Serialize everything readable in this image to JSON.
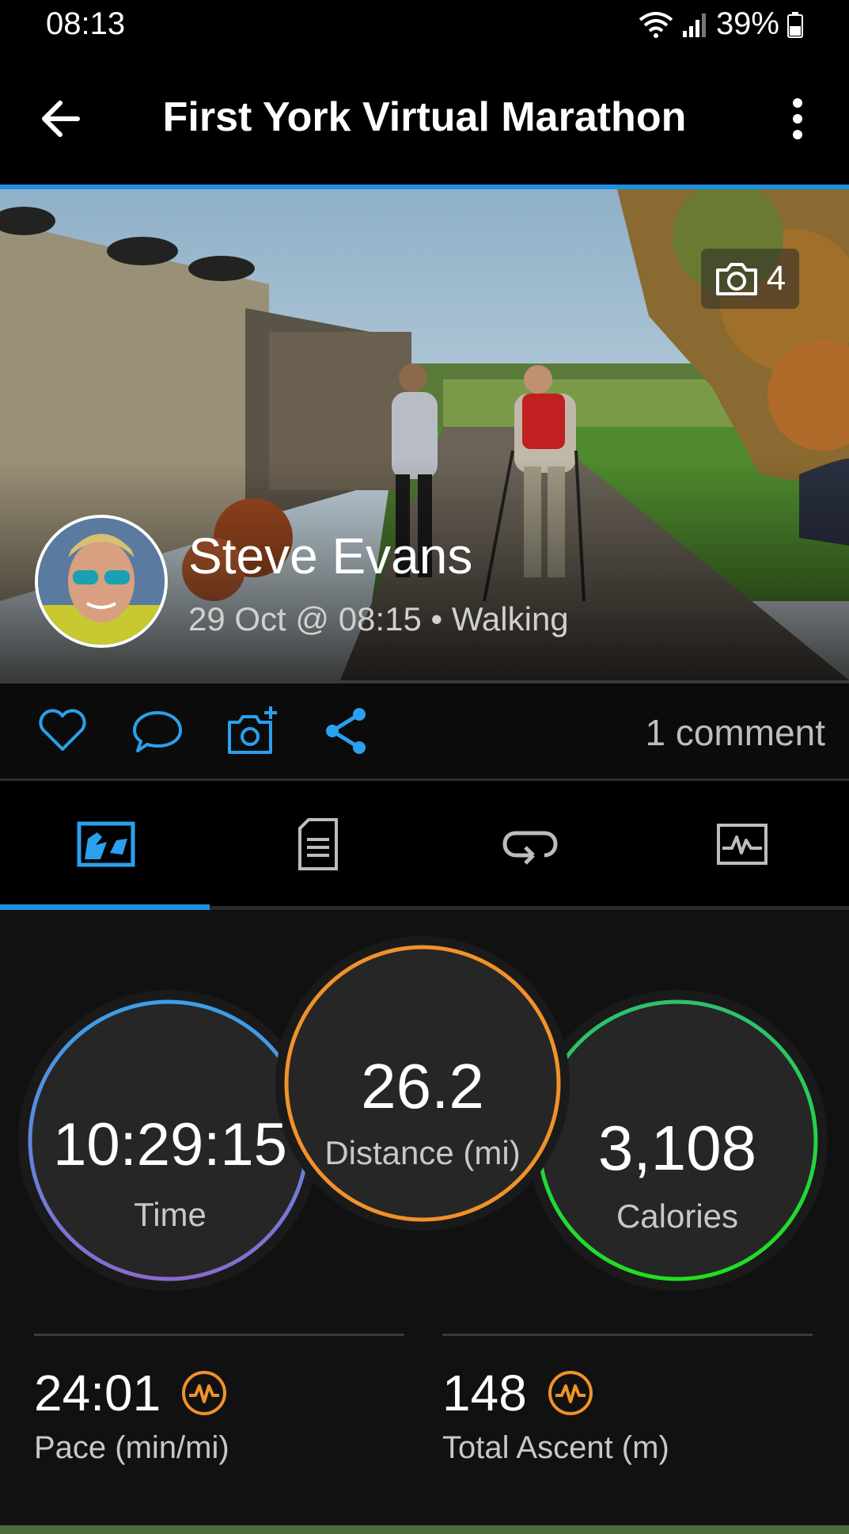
{
  "status_bar": {
    "time": "08:13",
    "battery": "39%"
  },
  "app_bar": {
    "title": "First York Virtual Marathon"
  },
  "hero": {
    "photo_count": "4",
    "user_name": "Steve Evans",
    "meta": "29 Oct @ 08:15 • Walking"
  },
  "actions": {
    "comment_count": "1 comment",
    "icons": [
      "heart-icon",
      "comment-icon",
      "add-photo-icon",
      "share-icon"
    ]
  },
  "tabs": [
    {
      "name": "overview",
      "icon": "overview-icon",
      "active": true
    },
    {
      "name": "details",
      "icon": "details-icon",
      "active": false
    },
    {
      "name": "laps",
      "icon": "laps-icon",
      "active": false
    },
    {
      "name": "charts",
      "icon": "chart-icon",
      "active": false
    }
  ],
  "stats": {
    "time": {
      "value": "10:29:15",
      "label": "Time"
    },
    "distance": {
      "value": "26.2",
      "label": "Distance (mi)"
    },
    "calories": {
      "value": "3,108",
      "label": "Calories"
    },
    "pace": {
      "value": "24:01",
      "label": "Pace (min/mi)"
    },
    "ascent": {
      "value": "148",
      "label": "Total Ascent (m)"
    }
  },
  "colors": {
    "accent": "#1e90e0",
    "time_ring": [
      "#3aa0e8",
      "#8a6ad0"
    ],
    "distance_ring": "#f0922a",
    "calories_ring": [
      "#2ec070",
      "#20e020"
    ],
    "badge": "#f0922a"
  }
}
